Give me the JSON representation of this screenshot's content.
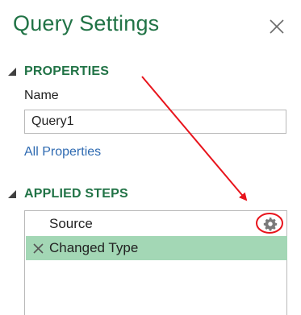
{
  "panel": {
    "title": "Query Settings",
    "close_icon": "close-icon"
  },
  "properties": {
    "section_title": "PROPERTIES",
    "name_label": "Name",
    "name_value": "Query1",
    "all_properties_link": "All Properties"
  },
  "applied_steps": {
    "section_title": "APPLIED STEPS",
    "steps": [
      {
        "label": "Source",
        "icon": "gear-icon",
        "selected": false
      },
      {
        "label": "Changed Type",
        "icon": "delete-step-icon",
        "selected": true
      }
    ]
  },
  "colors": {
    "accent_green": "#217346",
    "link_blue": "#2e6ab1",
    "selected_row": "#a3d7b5",
    "annotation_red": "#e8141c"
  }
}
